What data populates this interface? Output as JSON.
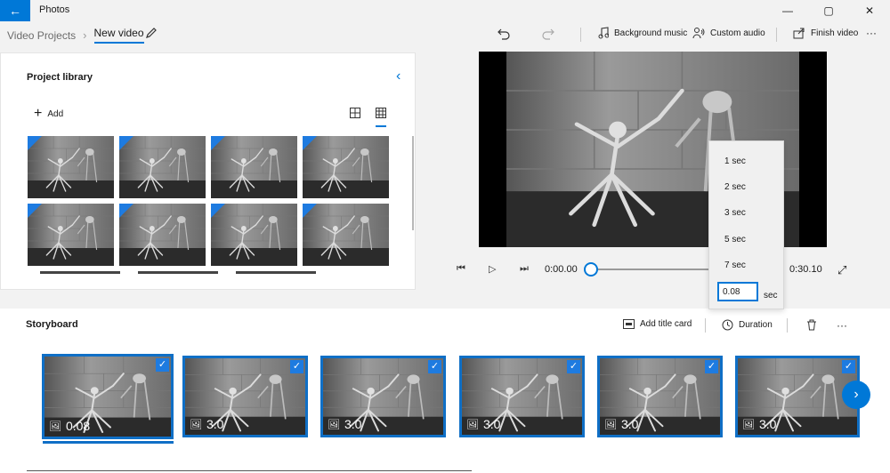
{
  "app": {
    "title": "Photos"
  },
  "window": {
    "minimize_glyph": "—",
    "maximize_glyph": "▢",
    "close_glyph": "✕"
  },
  "breadcrumb": {
    "root": "Video Projects",
    "separator": "›",
    "current": "New video"
  },
  "toolbar": {
    "background_music": "Background music",
    "custom_audio": "Custom audio",
    "finish_video": "Finish video",
    "more": "···"
  },
  "library": {
    "title": "Project library",
    "add_label": "Add",
    "collapse_glyph": "‹"
  },
  "player": {
    "time_current": "0:00.00",
    "time_total": "0:30.10",
    "progress": 0.0
  },
  "duration_menu": {
    "options": [
      "1 sec",
      "2 sec",
      "3 sec",
      "5 sec",
      "7 sec"
    ],
    "custom_value": "0.08",
    "unit": "sec"
  },
  "storyboard": {
    "title": "Storyboard",
    "add_title_card": "Add title card",
    "duration": "Duration",
    "more": "···",
    "clips": [
      {
        "duration": "0.08",
        "checked": true
      },
      {
        "duration": "3.0",
        "checked": true
      },
      {
        "duration": "3.0",
        "checked": true
      },
      {
        "duration": "3.0",
        "checked": true
      },
      {
        "duration": "3.0",
        "checked": true
      },
      {
        "duration": "3.0",
        "checked": true
      }
    ]
  },
  "colors": {
    "accent": "#0078d7",
    "clip_border": "#0f6fc6",
    "check_bg": "#1e7be0"
  },
  "icons": {
    "back": "back-arrow-icon",
    "edit": "pencil-icon",
    "undo": "undo-icon",
    "redo": "redo-icon",
    "music": "music-note-icon",
    "custom_audio": "person-audio-icon",
    "share": "share-icon",
    "add": "plus-icon",
    "grid_large": "grid-large-icon",
    "grid_small": "grid-small-icon",
    "prev_frame": "previous-frame-icon",
    "play": "play-icon",
    "next_frame": "next-frame-icon",
    "fullscreen": "fullscreen-icon",
    "title_card": "title-card-icon",
    "duration": "clock-icon",
    "delete": "trash-icon",
    "image": "image-icon",
    "check": "checkmark-icon",
    "next": "chevron-right-icon"
  }
}
